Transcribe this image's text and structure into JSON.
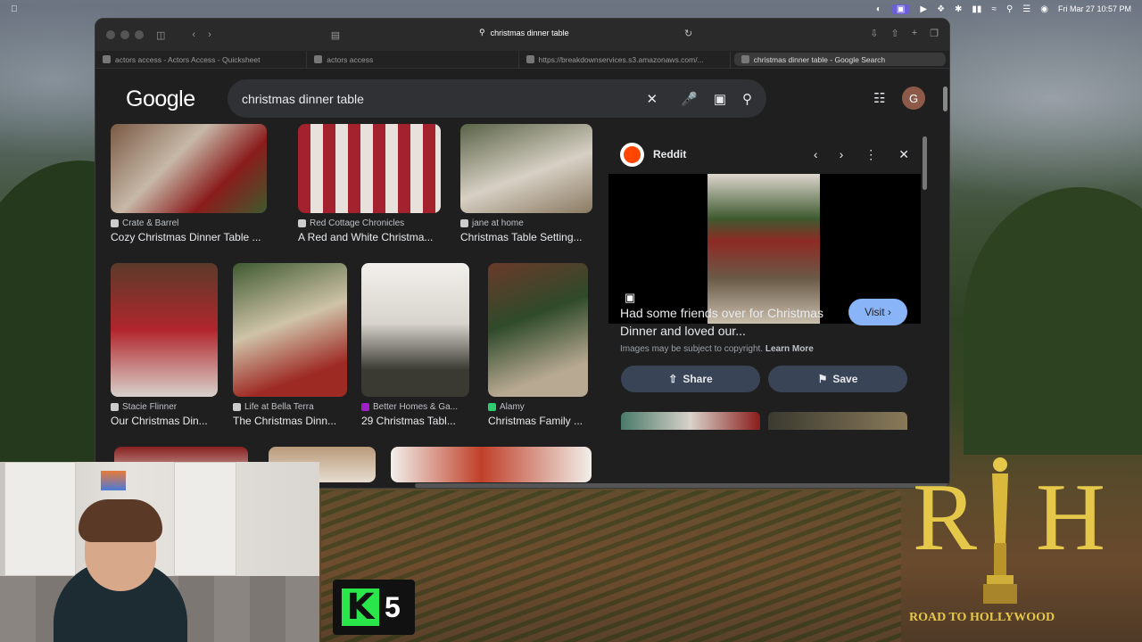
{
  "menubar": {
    "datetime": "Fri Mar 27  10:57 PM"
  },
  "browser": {
    "address": "christmas dinner table",
    "tabs": [
      {
        "label": "actors access - Actors Access - Quicksheet"
      },
      {
        "label": "actors access"
      },
      {
        "label": "https://breakdownservices.s3.amazonaws.com/..."
      },
      {
        "label": "christmas dinner table - Google Search"
      }
    ]
  },
  "google": {
    "logo": "Google",
    "query": "christmas dinner table",
    "avatar_letter": "G"
  },
  "results": [
    {
      "source": "Crate & Barrel",
      "title": "Cozy Christmas Dinner Table ..."
    },
    {
      "source": "Red Cottage Chronicles",
      "title": "A Red and White Christma..."
    },
    {
      "source": "jane at home",
      "title": "Christmas Table Setting..."
    },
    {
      "source": "Stacie Flinner",
      "title": "Our Christmas Din..."
    },
    {
      "source": "Life at Bella Terra",
      "title": "The Christmas Dinn..."
    },
    {
      "source": "Better Homes & Ga...",
      "title": "29 Christmas Tabl..."
    },
    {
      "source": "Alamy",
      "title": "Christmas Family ..."
    }
  ],
  "panel": {
    "site": "Reddit",
    "title": "Had some friends over for Christmas Dinner and loved our...",
    "visit_label": "Visit",
    "copyright": "Images may be subject to copyright.",
    "learn_more": "Learn More",
    "share_label": "Share",
    "save_label": "Save"
  },
  "overlay": {
    "k5_letter": "K",
    "k5_number": "5",
    "rth_letters": "RH",
    "rth_tagline": "ROAD TO HOLLYWOOD"
  },
  "colors": {
    "google_bg": "#1f1f1f",
    "search_bg": "#303134",
    "visit_bg": "#8ab4f8",
    "button_bg": "#394457",
    "k5_green": "#2ae64b",
    "rth_gold": "#e5c84a"
  }
}
